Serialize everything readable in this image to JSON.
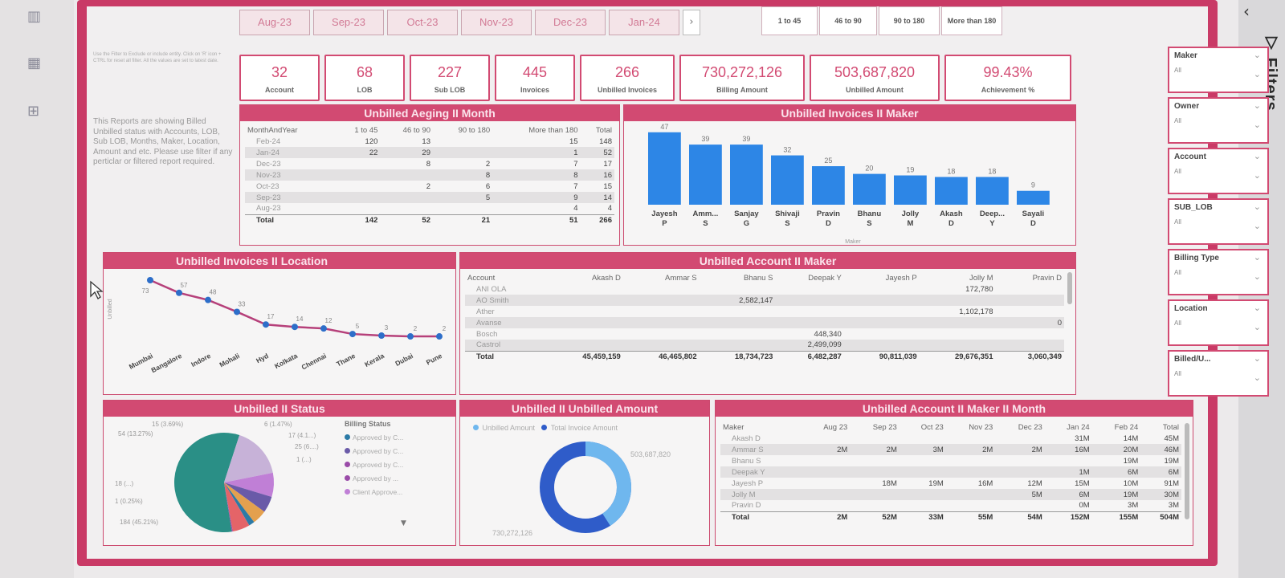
{
  "months": [
    "Aug-23",
    "Sep-23",
    "Oct-23",
    "Nov-23",
    "Dec-23",
    "Jan-24"
  ],
  "aging_buttons": [
    "1 to 45",
    "46 to 90",
    "90 to 180",
    "More than 180"
  ],
  "note_top": "Use the Filter to Exclude or include entity. Click on 'R' icon + CTRL for reset all filter. All the values are set to latest date.",
  "note_main": "This Reports are showing Billed Unbilled status with Accounts, LOB, Sub LOB, Months, Maker, Location, Amount and etc. Please use filter if any perticlar or filtered report required.",
  "kpis": [
    {
      "value": "32",
      "label": "Account"
    },
    {
      "value": "68",
      "label": "LOB"
    },
    {
      "value": "227",
      "label": "Sub LOB"
    },
    {
      "value": "445",
      "label": "Invoices"
    },
    {
      "value": "266",
      "label": "Unbilled Invoices"
    },
    {
      "value": "730,272,126",
      "label": "Billing Amount"
    },
    {
      "value": "503,687,820",
      "label": "Unbilled Amount"
    },
    {
      "value": "99.43%",
      "label": "Achievement %"
    }
  ],
  "slicers": [
    {
      "title": "Maker",
      "value": "All"
    },
    {
      "title": "Owner",
      "value": "All"
    },
    {
      "title": "Account",
      "value": "All"
    },
    {
      "title": "SUB_LOB",
      "value": "All"
    },
    {
      "title": "Billing Type",
      "value": "All"
    },
    {
      "title": "Location",
      "value": "All"
    },
    {
      "title": "Billed/U...",
      "value": "All"
    }
  ],
  "aging": {
    "title": "Unbilled Aeging II Month",
    "headers": [
      "MonthAndYear",
      "1 to 45",
      "46 to 90",
      "90 to 180",
      "More than 180",
      "Total"
    ],
    "rows": [
      [
        "Feb-24",
        "120",
        "13",
        "",
        "15",
        "148"
      ],
      [
        "Jan-24",
        "22",
        "29",
        "",
        "1",
        "52"
      ],
      [
        "Dec-23",
        "",
        "8",
        "2",
        "7",
        "17"
      ],
      [
        "Nov-23",
        "",
        "",
        "8",
        "8",
        "16"
      ],
      [
        "Oct-23",
        "",
        "2",
        "6",
        "7",
        "15"
      ],
      [
        "Sep-23",
        "",
        "",
        "5",
        "9",
        "14"
      ],
      [
        "Aug-23",
        "",
        "",
        "",
        "4",
        "4"
      ]
    ],
    "total": [
      "Total",
      "142",
      "52",
      "21",
      "51",
      "266"
    ]
  },
  "maker_chart": {
    "title": "Unbilled Invoices II Maker",
    "xlabel": "Maker",
    "chart_data": {
      "type": "bar",
      "categories": [
        "Jayesh P",
        "Amm... S",
        "Sanjay G",
        "Shivaji S",
        "Pravin D",
        "Bhanu S",
        "Jolly M",
        "Akash D",
        "Deep... Y",
        "Sayali D"
      ],
      "values": [
        47,
        39,
        39,
        32,
        25,
        20,
        19,
        18,
        18,
        9
      ],
      "ylim": [
        0,
        50
      ],
      "color": "#2d86e6"
    }
  },
  "location_chart": {
    "title": "Unbilled Invoices II Location",
    "ylabel": "Unbilled",
    "chart_data": {
      "type": "line",
      "categories": [
        "Mumbai",
        "Bangalore",
        "Indore",
        "Mohali",
        "Hyd",
        "Kolkata",
        "Chennai",
        "Thane",
        "Kerala",
        "Dubai",
        "Pune"
      ],
      "values": [
        73,
        57,
        48,
        33,
        17,
        14,
        12,
        5,
        3,
        2,
        2
      ],
      "color": "#2d6ec9"
    }
  },
  "account_maker": {
    "title": "Unbilled Account II Maker",
    "headers": [
      "Account",
      "Akash D",
      "Ammar S",
      "Bhanu S",
      "Deepak Y",
      "Jayesh P",
      "Jolly M",
      "Pravin D"
    ],
    "rows": [
      [
        "ANI OLA",
        "",
        "",
        "",
        "",
        "",
        "172,780",
        ""
      ],
      [
        "AO Smith",
        "",
        "",
        "2,582,147",
        "",
        "",
        "",
        ""
      ],
      [
        "Ather",
        "",
        "",
        "",
        "",
        "",
        "1,102,178",
        ""
      ],
      [
        "Avanse",
        "",
        "",
        "",
        "",
        "",
        "",
        "0"
      ],
      [
        "Bosch",
        "",
        "",
        "",
        "448,340",
        "",
        "",
        ""
      ],
      [
        "Castrol",
        "",
        "",
        "",
        "2,499,099",
        "",
        "",
        ""
      ]
    ],
    "total": [
      "Total",
      "45,459,159",
      "46,465,802",
      "18,734,723",
      "6,482,287",
      "90,811,039",
      "29,676,351",
      "3,060,349"
    ]
  },
  "status": {
    "title": "Unbilled II Status",
    "legend_title": "Billing Status",
    "legend": [
      "Approved by C...",
      "Approved by C...",
      "Approved by C...",
      "Approved by ...",
      "Client Approve..."
    ],
    "labels": [
      "15 (3.69%)",
      "6 (1.47%)",
      "17 (4.1...)",
      "25 (6....)",
      "1 (...)",
      "54 (13.27%)",
      "18 (...)",
      "1 (0.25%)",
      "184 (45.21%)"
    ],
    "chart_data": {
      "type": "pie",
      "categories": [
        "184 (45.21%)",
        "54 (13.27%)",
        "25 (6....)",
        "17 (4.1...)",
        "15 (3.69%)",
        "6 (1.47%)",
        "18 (...)",
        "1 (0.25%)"
      ],
      "values": [
        184,
        54,
        25,
        17,
        15,
        6,
        18,
        1
      ]
    }
  },
  "amount": {
    "title": "Unbilled II Unbilled Amount",
    "legend": [
      "Unbilled Amount",
      "Total Invoice Amount"
    ],
    "unbilled_label": "503,687,820",
    "total_label": "730,272,126",
    "chart_data": {
      "type": "pie",
      "categories": [
        "Unbilled Amount",
        "Total Invoice Amount"
      ],
      "values": [
        503687820,
        730272126
      ],
      "colors": [
        "#6fb7ee",
        "#2f5cc9"
      ]
    }
  },
  "maker_month": {
    "title": "Unbilled Account II Maker II Month",
    "headers": [
      "Maker",
      "Aug 23",
      "Sep 23",
      "Oct 23",
      "Nov 23",
      "Dec 23",
      "Jan 24",
      "Feb 24",
      "Total"
    ],
    "rows": [
      [
        "Akash D",
        "",
        "",
        "",
        "",
        "",
        "31M",
        "14M",
        "45M"
      ],
      [
        "Ammar S",
        "2M",
        "2M",
        "3M",
        "2M",
        "2M",
        "16M",
        "20M",
        "46M"
      ],
      [
        "Bhanu S",
        "",
        "",
        "",
        "",
        "",
        "",
        "19M",
        "19M"
      ],
      [
        "Deepak Y",
        "",
        "",
        "",
        "",
        "",
        "1M",
        "6M",
        "6M"
      ],
      [
        "Jayesh P",
        "",
        "18M",
        "19M",
        "16M",
        "12M",
        "15M",
        "10M",
        "91M"
      ],
      [
        "Jolly M",
        "",
        "",
        "",
        "",
        "5M",
        "6M",
        "19M",
        "30M"
      ],
      [
        "Pravin D",
        "",
        "",
        "",
        "",
        "",
        "0M",
        "3M",
        "3M"
      ]
    ],
    "total": [
      "Total",
      "2M",
      "52M",
      "33M",
      "55M",
      "54M",
      "152M",
      "155M",
      "504M"
    ]
  }
}
